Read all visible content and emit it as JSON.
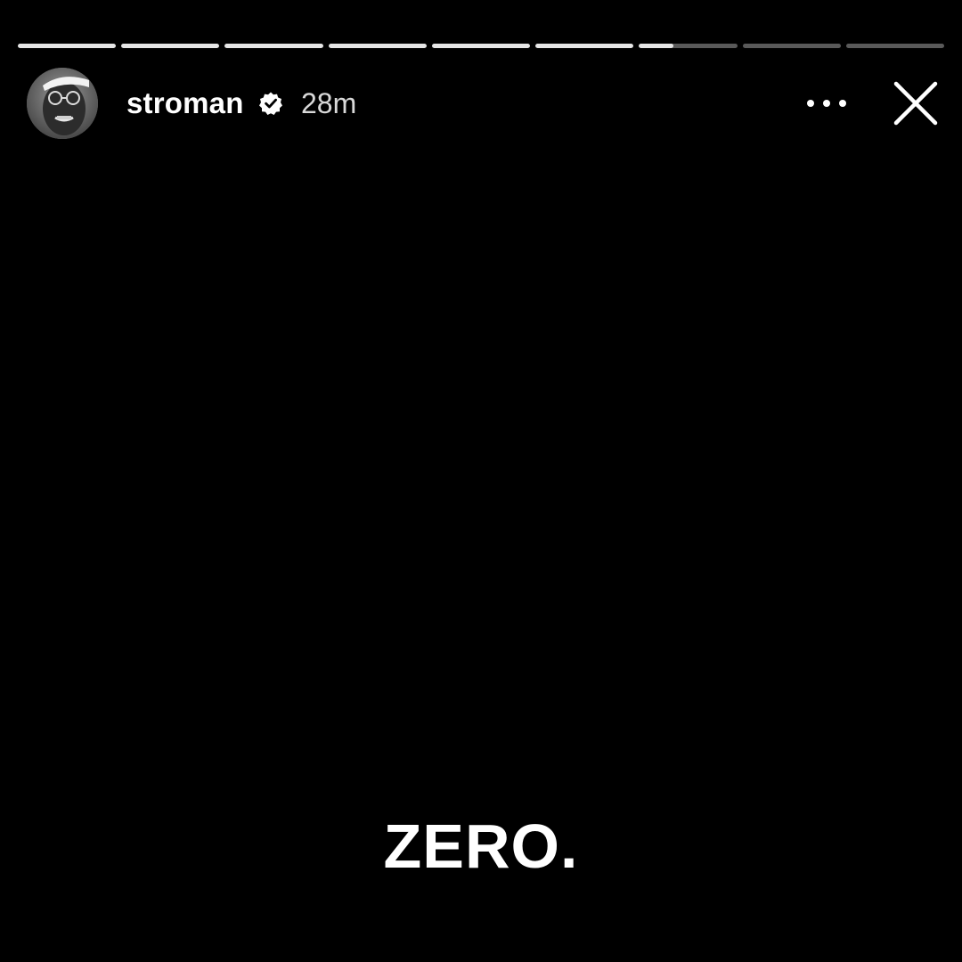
{
  "progress": {
    "segments": [
      1,
      1,
      1,
      1,
      1,
      1,
      0.35,
      0,
      0
    ]
  },
  "header": {
    "username": "stroman",
    "verified": true,
    "timestamp": "28m"
  },
  "icons": {
    "verified": "verified-badge-icon",
    "more": "more-horizontal-icon",
    "close": "close-icon"
  },
  "story": {
    "caption": "ZERO."
  },
  "colors": {
    "background": "#000000",
    "text": "#ffffff",
    "progress_filled": "#e6e6e6",
    "progress_empty": "rgba(255,255,255,0.35)"
  }
}
